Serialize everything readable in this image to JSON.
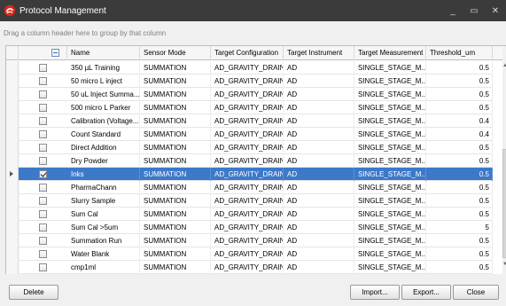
{
  "window": {
    "title": "Protocol Management",
    "controls": {
      "minimize": "_",
      "maximize": "▭",
      "close": "✕"
    },
    "accent": "#d9261c"
  },
  "group_panel": {
    "hint": "Drag a column header here to group by that column"
  },
  "grid": {
    "columns": [
      "Name",
      "Sensor Mode",
      "Target Configuration",
      "Target Instrument",
      "Target Measurement",
      "Threshold_um"
    ],
    "selected_color": "#3d79c9",
    "rows": [
      {
        "checked": false,
        "selected": false,
        "name": "350 µL Training",
        "sensor_mode": "SUMMATION",
        "target_configuration": "AD_GRAVITY_DRAIN",
        "target_instrument": "AD",
        "target_measurement": "SINGLE_STAGE_M...",
        "threshold": "0.5"
      },
      {
        "checked": false,
        "selected": false,
        "name": "50 micro L inject",
        "sensor_mode": "SUMMATION",
        "target_configuration": "AD_GRAVITY_DRAIN",
        "target_instrument": "AD",
        "target_measurement": "SINGLE_STAGE_M...",
        "threshold": "0.5"
      },
      {
        "checked": false,
        "selected": false,
        "name": "50 uL Inject Summa...",
        "sensor_mode": "SUMMATION",
        "target_configuration": "AD_GRAVITY_DRAIN",
        "target_instrument": "AD",
        "target_measurement": "SINGLE_STAGE_M...",
        "threshold": "0.5"
      },
      {
        "checked": false,
        "selected": false,
        "name": "500 micro L Parker",
        "sensor_mode": "SUMMATION",
        "target_configuration": "AD_GRAVITY_DRAIN",
        "target_instrument": "AD",
        "target_measurement": "SINGLE_STAGE_M...",
        "threshold": "0.5"
      },
      {
        "checked": false,
        "selected": false,
        "name": "Calibration (Voltage...",
        "sensor_mode": "SUMMATION",
        "target_configuration": "AD_GRAVITY_DRAIN",
        "target_instrument": "AD",
        "target_measurement": "SINGLE_STAGE_M...",
        "threshold": "0.4"
      },
      {
        "checked": false,
        "selected": false,
        "name": "Count Standard",
        "sensor_mode": "SUMMATION",
        "target_configuration": "AD_GRAVITY_DRAIN",
        "target_instrument": "AD",
        "target_measurement": "SINGLE_STAGE_M...",
        "threshold": "0.4"
      },
      {
        "checked": false,
        "selected": false,
        "name": "Direct Addition",
        "sensor_mode": "SUMMATION",
        "target_configuration": "AD_GRAVITY_DRAIN",
        "target_instrument": "AD",
        "target_measurement": "SINGLE_STAGE_M...",
        "threshold": "0.5"
      },
      {
        "checked": false,
        "selected": false,
        "name": "Dry Powder",
        "sensor_mode": "SUMMATION",
        "target_configuration": "AD_GRAVITY_DRAIN",
        "target_instrument": "AD",
        "target_measurement": "SINGLE_STAGE_M...",
        "threshold": "0.5"
      },
      {
        "checked": true,
        "selected": true,
        "name": "Inks",
        "sensor_mode": "SUMMATION",
        "target_configuration": "AD_GRAVITY_DRAIN",
        "target_instrument": "AD",
        "target_measurement": "SINGLE_STAGE_M...",
        "threshold": "0.5"
      },
      {
        "checked": false,
        "selected": false,
        "name": "PharmaChann",
        "sensor_mode": "SUMMATION",
        "target_configuration": "AD_GRAVITY_DRAIN",
        "target_instrument": "AD",
        "target_measurement": "SINGLE_STAGE_M...",
        "threshold": "0.5"
      },
      {
        "checked": false,
        "selected": false,
        "name": "Slurry Sample",
        "sensor_mode": "SUMMATION",
        "target_configuration": "AD_GRAVITY_DRAIN",
        "target_instrument": "AD",
        "target_measurement": "SINGLE_STAGE_M...",
        "threshold": "0.5"
      },
      {
        "checked": false,
        "selected": false,
        "name": "Sum Cal",
        "sensor_mode": "SUMMATION",
        "target_configuration": "AD_GRAVITY_DRAIN",
        "target_instrument": "AD",
        "target_measurement": "SINGLE_STAGE_M...",
        "threshold": "0.5"
      },
      {
        "checked": false,
        "selected": false,
        "name": "Sum Cal >5um",
        "sensor_mode": "SUMMATION",
        "target_configuration": "AD_GRAVITY_DRAIN",
        "target_instrument": "AD",
        "target_measurement": "SINGLE_STAGE_M...",
        "threshold": "5"
      },
      {
        "checked": false,
        "selected": false,
        "name": "Summation Run",
        "sensor_mode": "SUMMATION",
        "target_configuration": "AD_GRAVITY_DRAIN",
        "target_instrument": "AD",
        "target_measurement": "SINGLE_STAGE_M...",
        "threshold": "0.5"
      },
      {
        "checked": false,
        "selected": false,
        "name": "Water Blank",
        "sensor_mode": "SUMMATION",
        "target_configuration": "AD_GRAVITY_DRAIN",
        "target_instrument": "AD",
        "target_measurement": "SINGLE_STAGE_M...",
        "threshold": "0.5"
      },
      {
        "checked": false,
        "selected": false,
        "name": "cmp1ml",
        "sensor_mode": "SUMMATION",
        "target_configuration": "AD_GRAVITY_DRAIN",
        "target_instrument": "AD",
        "target_measurement": "SINGLE_STAGE_M...",
        "threshold": "0.5"
      }
    ]
  },
  "scrollbar": {
    "up": "▲",
    "down": "▼"
  },
  "footer": {
    "delete_label": "Delete",
    "import_label": "Import...",
    "export_label": "Export...",
    "close_label": "Close"
  }
}
